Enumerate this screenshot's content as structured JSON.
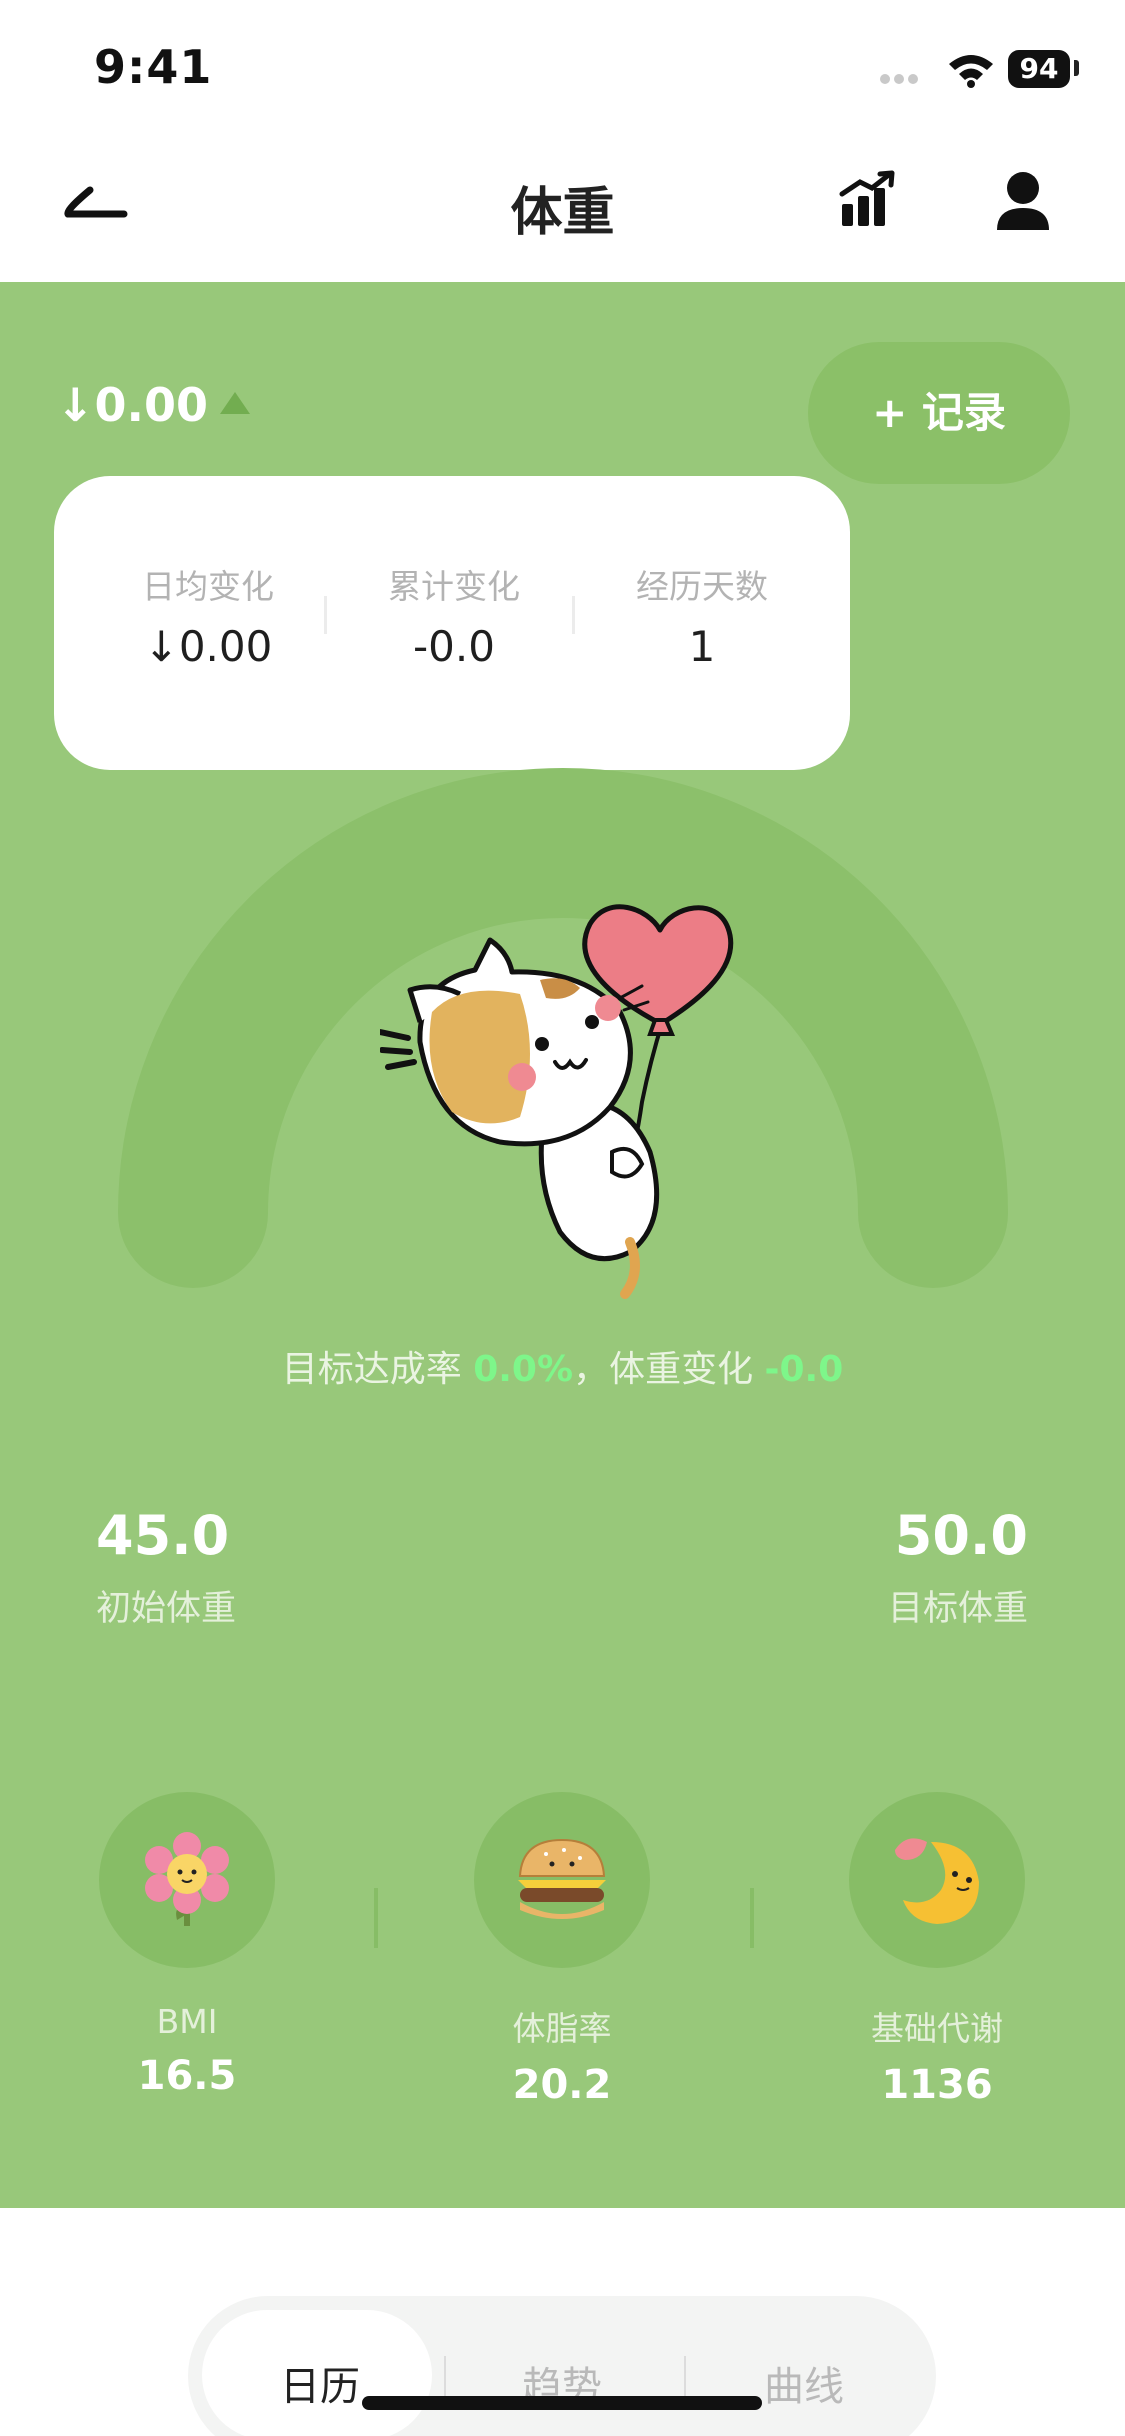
{
  "status_bar": {
    "time": "9:41",
    "battery": "94"
  },
  "nav": {
    "title": "体重"
  },
  "summary": {
    "change": "↓0.00",
    "record_button": "+ 记录"
  },
  "stats_card": {
    "items": [
      {
        "label": "日均变化",
        "value": "↓0.00"
      },
      {
        "label": "累计变化",
        "value": "-0.0"
      },
      {
        "label": "经历天数",
        "value": "1"
      }
    ]
  },
  "goal": {
    "rate_label": "目标达成率",
    "rate_value": "0.0%",
    "separator": "，",
    "change_label": "体重变化",
    "change_value": "-0.0"
  },
  "weights": {
    "start": {
      "value": "45.0",
      "label": "初始体重"
    },
    "target": {
      "value": "50.0",
      "label": "目标体重"
    }
  },
  "metrics": [
    {
      "label": "BMI",
      "value": "16.5",
      "icon": "flower-icon"
    },
    {
      "label": "体脂率",
      "value": "20.2",
      "icon": "burger-icon"
    },
    {
      "label": "基础代谢",
      "value": "1136",
      "icon": "moon-icon"
    }
  ],
  "tabs": [
    {
      "label": "日历",
      "active": true
    },
    {
      "label": "趋势",
      "active": false
    },
    {
      "label": "曲线",
      "active": false
    }
  ],
  "colors": {
    "panel": "#98c87a",
    "panel_dark": "#87bd66",
    "highlight": "#7ef68a"
  }
}
